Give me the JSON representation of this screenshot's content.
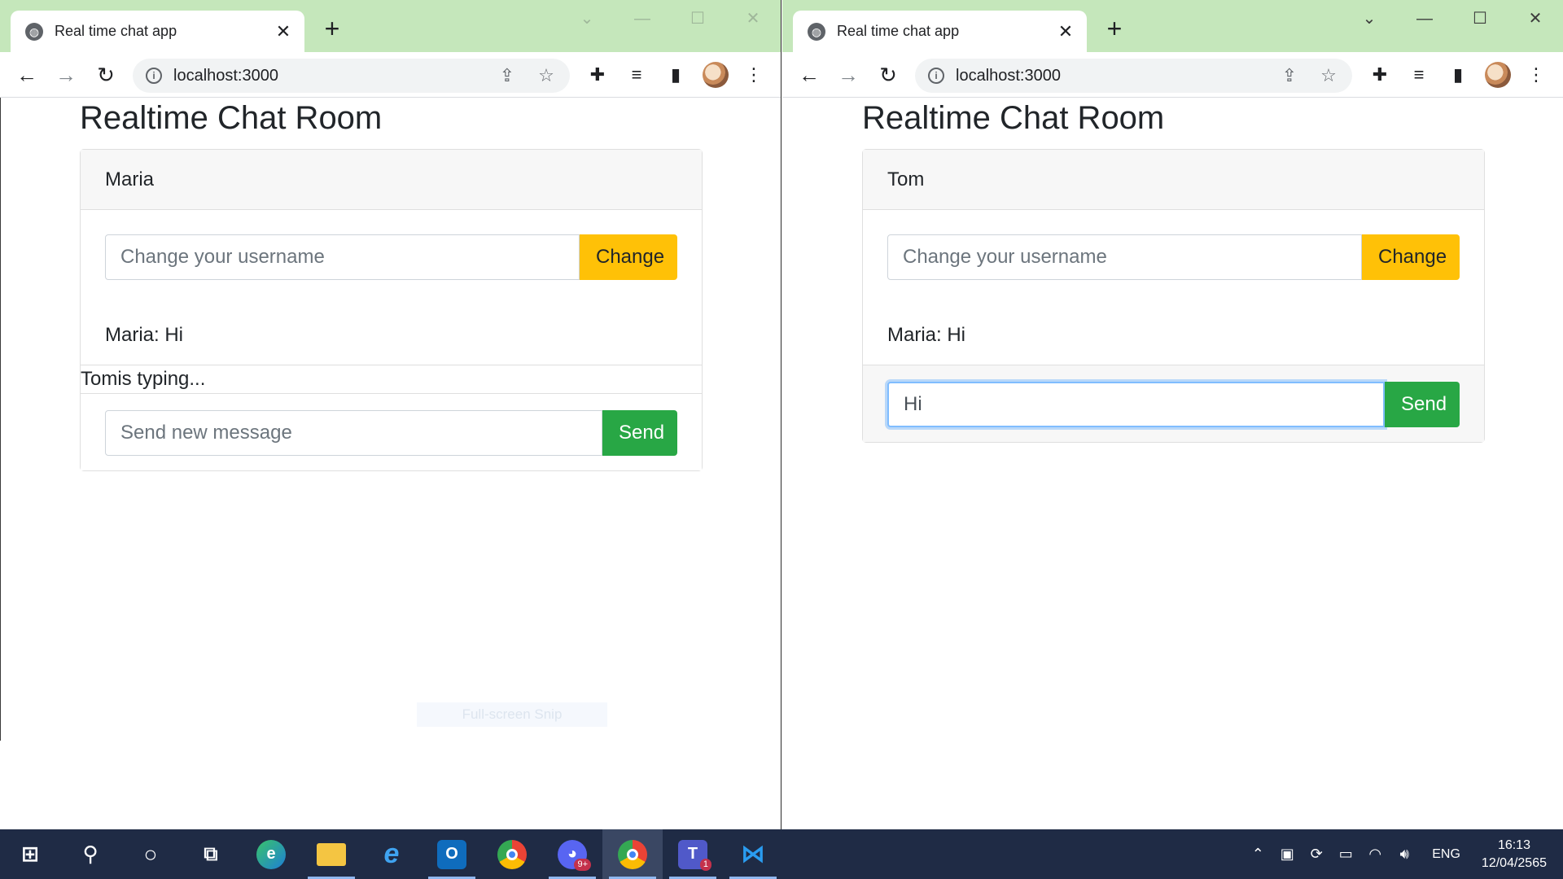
{
  "left_window": {
    "tab_title": "Real time chat app",
    "url": "localhost:3000",
    "page_title": "Realtime Chat Room",
    "username": "Maria",
    "username_placeholder": "Change your username",
    "change_label": "Change",
    "messages": [
      "Maria: Hi"
    ],
    "typing_indicator": "Tomis typing...",
    "message_placeholder": "Send new message",
    "message_value": "",
    "send_label": "Send"
  },
  "right_window": {
    "tab_title": "Real time chat app",
    "url": "localhost:3000",
    "page_title": "Realtime Chat Room",
    "username": "Tom",
    "username_placeholder": "Change your username",
    "change_label": "Change",
    "messages": [
      "Maria: Hi"
    ],
    "message_placeholder": "Send new message",
    "message_value": "Hi ",
    "send_label": "Send"
  },
  "snip_hint": "Full-screen Snip",
  "browser_icons": {
    "back": "arrow-left-icon",
    "forward": "arrow-right-icon",
    "reload": "reload-icon",
    "share": "share-icon",
    "bookmark": "star-icon",
    "extensions": "puzzle-icon",
    "media": "media-list-icon",
    "side_panel": "side-panel-icon",
    "menu": "kebab-menu-icon"
  },
  "taskbar": {
    "apps": [
      "start",
      "search",
      "cortana",
      "task-view",
      "edge",
      "file-explorer",
      "internet-explorer",
      "outlook",
      "chrome",
      "discord",
      "chrome-profile",
      "teams",
      "vscode"
    ],
    "teams_badge": "1",
    "discord_badge": "9+",
    "language": "ENG",
    "time": "16:13",
    "date": "12/04/2565"
  },
  "colors": {
    "titlebar": "#c5e7bb",
    "change_button": "#ffc107",
    "send_button": "#28a745",
    "taskbar": "#1f2b45"
  }
}
